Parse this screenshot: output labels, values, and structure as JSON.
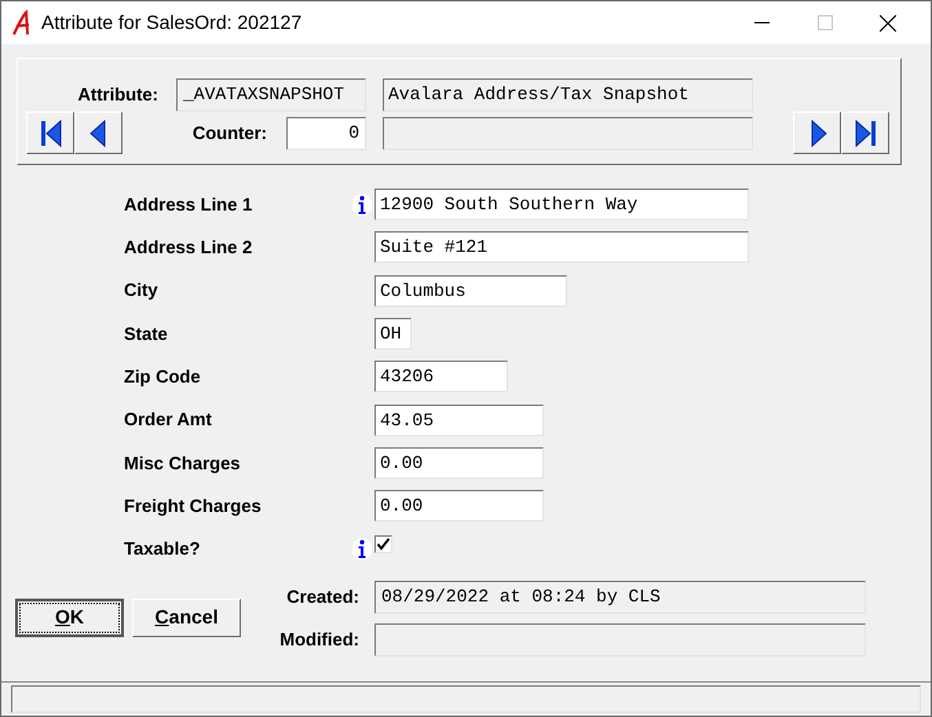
{
  "window": {
    "title": "Attribute for SalesOrd: 202127"
  },
  "header": {
    "attribute_label": "Attribute:",
    "attribute_code": "_AVATAXSNAPSHOT",
    "attribute_description": "Avalara Address/Tax Snapshot",
    "counter_label": "Counter:",
    "counter_value": "0"
  },
  "fields": [
    {
      "kind": "text",
      "label": "Address Line 1",
      "info": true,
      "value": "12900 South Southern Way"
    },
    {
      "kind": "text",
      "label": "Address Line 2",
      "info": false,
      "value": "Suite #121"
    },
    {
      "kind": "text",
      "label": "City",
      "info": false,
      "value": "Columbus"
    },
    {
      "kind": "text",
      "label": "State",
      "info": false,
      "value": "OH"
    },
    {
      "kind": "text",
      "label": "Zip Code",
      "info": false,
      "value": "43206"
    },
    {
      "kind": "text",
      "label": "Order Amt",
      "info": false,
      "value": "43.05"
    },
    {
      "kind": "text",
      "label": "Misc Charges",
      "info": false,
      "value": "0.00"
    },
    {
      "kind": "text",
      "label": "Freight Charges",
      "info": false,
      "value": "0.00"
    },
    {
      "kind": "checkbox",
      "label": "Taxable?",
      "info": true,
      "checked": true
    }
  ],
  "buttons": [
    {
      "mnemonic": "O",
      "rest": "K",
      "default": true
    },
    {
      "mnemonic": "C",
      "rest": "ancel",
      "default": false
    }
  ],
  "audit": [
    {
      "label": "Created:",
      "value": "08/29/2022 at 08:24 by CLS"
    },
    {
      "label": "Modified:"
    }
  ]
}
